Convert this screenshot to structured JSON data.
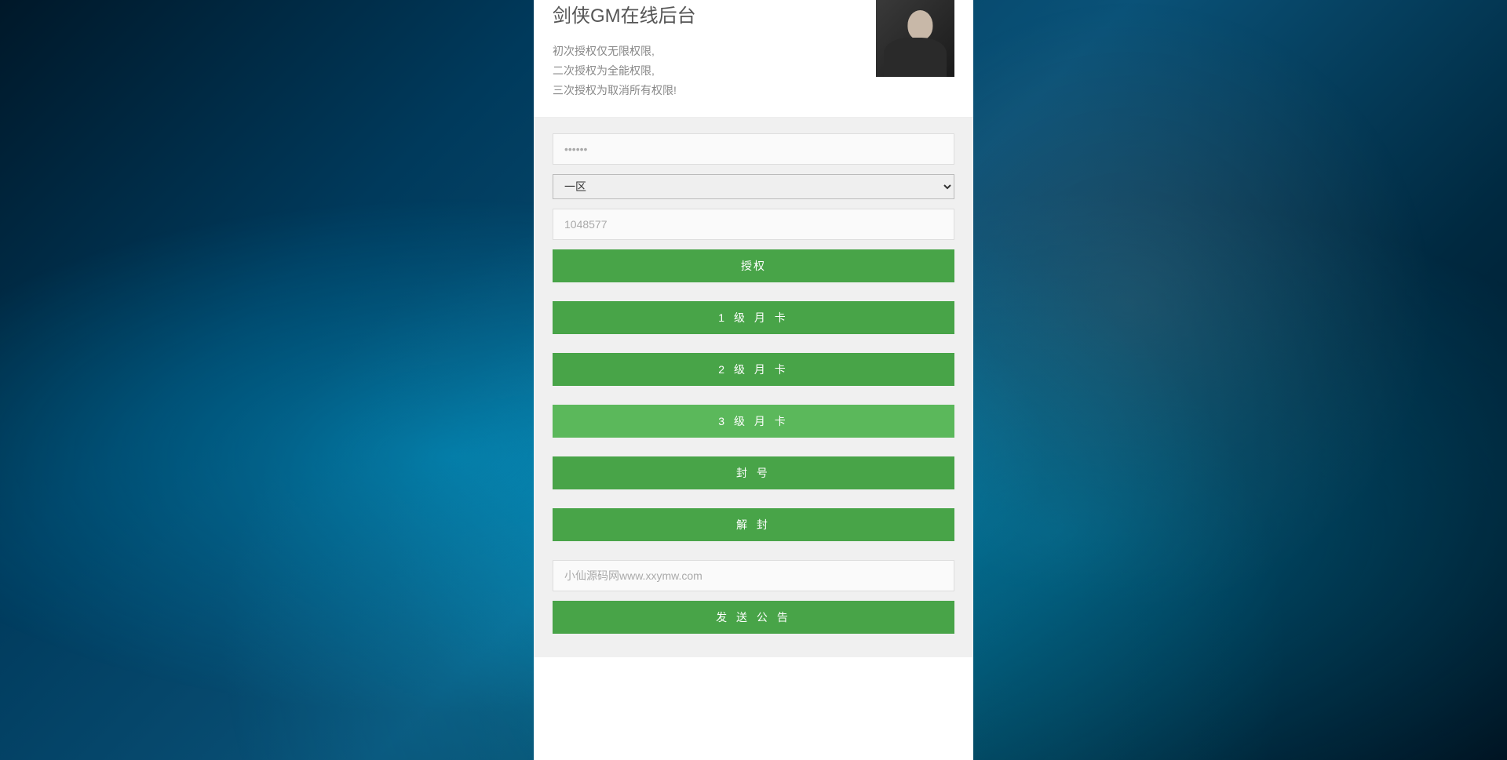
{
  "header": {
    "title": "剑侠GM在线后台",
    "desc_line1": "初次授权仅无限权限,",
    "desc_line2": "二次授权为全能权限,",
    "desc_line3": "三次授权为取消所有权限!"
  },
  "form": {
    "password_placeholder": "••••••",
    "zone_selected": "一区",
    "id_placeholder": "1048577",
    "announce_placeholder": "小仙源码网www.xxymw.com"
  },
  "buttons": {
    "authorize": "授权",
    "card1": "1 级 月 卡",
    "card2": "2 级 月 卡",
    "card3": "3 级 月 卡",
    "ban": "封 号",
    "unban": "解 封",
    "send_announce": "发 送 公 告"
  }
}
